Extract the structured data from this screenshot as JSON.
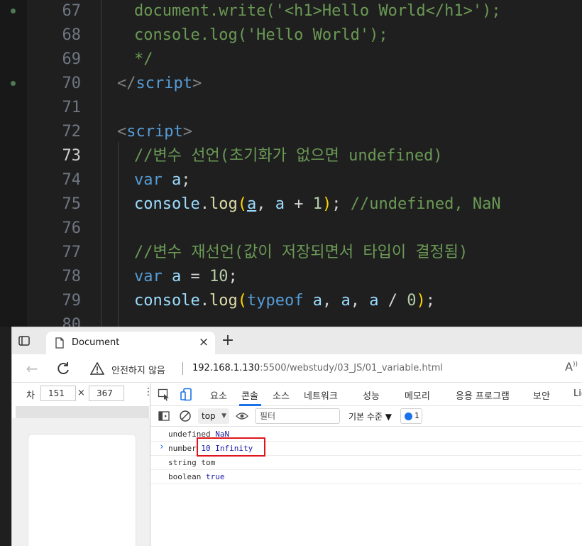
{
  "editor": {
    "lines": [
      {
        "num": "67",
        "tokens": [
          {
            "t": "document.write('<h1>Hello World</h1>');",
            "c": "c-com"
          }
        ]
      },
      {
        "num": "68",
        "tokens": [
          {
            "t": "console.log('Hello World');",
            "c": "c-com"
          }
        ]
      },
      {
        "num": "69",
        "tokens": [
          {
            "t": "*/",
            "c": "c-com"
          }
        ]
      },
      {
        "num": "70",
        "tokens": [
          {
            "t": "</",
            "c": "c-brk"
          },
          {
            "t": "script",
            "c": "c-tag"
          },
          {
            "t": ">",
            "c": "c-brk"
          }
        ]
      },
      {
        "num": "71",
        "tokens": []
      },
      {
        "num": "72",
        "tokens": [
          {
            "t": "<",
            "c": "c-brk"
          },
          {
            "t": "script",
            "c": "c-tag"
          },
          {
            "t": ">",
            "c": "c-brk"
          }
        ]
      },
      {
        "num": "73",
        "tokens": [
          {
            "t": "//변수 선언(초기화가 없으면 undefined)",
            "c": "c-com"
          }
        ]
      },
      {
        "num": "74",
        "tokens": [
          {
            "t": "var",
            "c": "c-kw"
          },
          {
            "t": " ",
            "c": "c-op"
          },
          {
            "t": "a",
            "c": "c-id"
          },
          {
            "t": ";",
            "c": "c-op"
          }
        ]
      },
      {
        "num": "75",
        "tokens": [
          {
            "t": "console",
            "c": "c-id"
          },
          {
            "t": ".",
            "c": "c-op"
          },
          {
            "t": "log",
            "c": "c-fn"
          },
          {
            "t": "(",
            "c": "c-par"
          },
          {
            "t": "a",
            "c": "c-id c-u"
          },
          {
            "t": ", ",
            "c": "c-op"
          },
          {
            "t": "a",
            "c": "c-id"
          },
          {
            "t": " + ",
            "c": "c-op"
          },
          {
            "t": "1",
            "c": "c-num"
          },
          {
            "t": ")",
            "c": "c-par"
          },
          {
            "t": "; ",
            "c": "c-op"
          },
          {
            "t": "//undefined, NaN",
            "c": "c-com"
          }
        ]
      },
      {
        "num": "76",
        "tokens": []
      },
      {
        "num": "77",
        "tokens": [
          {
            "t": "//변수 재선언(값이 저장되면서 타입이 결정됨)",
            "c": "c-com"
          }
        ]
      },
      {
        "num": "78",
        "tokens": [
          {
            "t": "var",
            "c": "c-kw"
          },
          {
            "t": " ",
            "c": "c-op"
          },
          {
            "t": "a",
            "c": "c-id"
          },
          {
            "t": " = ",
            "c": "c-op"
          },
          {
            "t": "10",
            "c": "c-num"
          },
          {
            "t": ";",
            "c": "c-op"
          }
        ]
      },
      {
        "num": "79",
        "tokens": [
          {
            "t": "console",
            "c": "c-id"
          },
          {
            "t": ".",
            "c": "c-op"
          },
          {
            "t": "log",
            "c": "c-fn"
          },
          {
            "t": "(",
            "c": "c-par"
          },
          {
            "t": "typeof",
            "c": "c-kw"
          },
          {
            "t": " ",
            "c": "c-op"
          },
          {
            "t": "a",
            "c": "c-id"
          },
          {
            "t": ", ",
            "c": "c-op"
          },
          {
            "t": "a",
            "c": "c-id"
          },
          {
            "t": ", ",
            "c": "c-op"
          },
          {
            "t": "a",
            "c": "c-id"
          },
          {
            "t": " / ",
            "c": "c-op"
          },
          {
            "t": "0",
            "c": "c-num"
          },
          {
            "t": ")",
            "c": "c-par"
          },
          {
            "t": ";",
            "c": "c-op"
          }
        ]
      },
      {
        "num": "80",
        "tokens": []
      }
    ]
  },
  "browser": {
    "tab_title": "Document",
    "address": {
      "security_label": "안전하지 않음",
      "host": "192.168.1.130",
      "path": ":5500/webstudy/03_JS/01_variable.html"
    },
    "device_toolbar": {
      "label": "차",
      "width": "151",
      "height": "367",
      "times": "×"
    },
    "devtools": {
      "tabs": [
        "요소",
        "콘솔",
        "소스",
        "네트워크",
        "성능",
        "메모리",
        "응용 프로그램",
        "보안",
        "Lig"
      ],
      "active_tab": "콘솔",
      "context": "top",
      "filter_placeholder": "필터",
      "levels": "기본 수준 ▼",
      "issues": "1",
      "console_rows": [
        [
          {
            "t": "undefined ",
            "c": "v-plain"
          },
          {
            "t": "NaN",
            "c": "v-blue"
          }
        ],
        [
          {
            "t": "number ",
            "c": "v-plain"
          },
          {
            "t": "10",
            "c": "v-blue"
          },
          {
            "t": " ",
            "c": "v-plain"
          },
          {
            "t": "Infinity",
            "c": "v-blue"
          }
        ],
        [
          {
            "t": "string tom",
            "c": "v-plain"
          }
        ],
        [
          {
            "t": "boolean ",
            "c": "v-plain"
          },
          {
            "t": "true",
            "c": "v-blue"
          }
        ]
      ],
      "prompt": "›"
    }
  },
  "colors": {
    "accent": "#1a73e8",
    "highlight": "#e0151b",
    "editor_bg": "#1f1f1f"
  }
}
